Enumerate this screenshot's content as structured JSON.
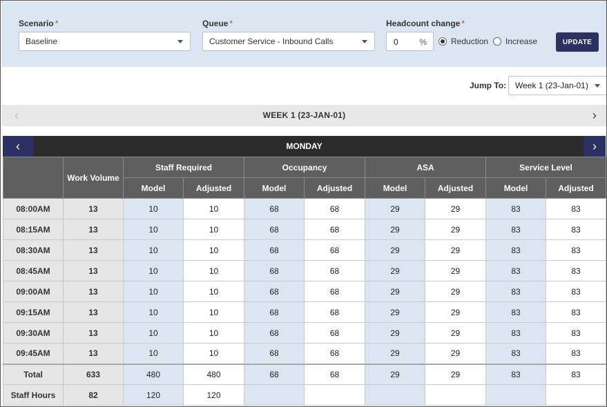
{
  "filters": {
    "scenario": {
      "label": "Scenario",
      "required": "*",
      "value": "Baseline"
    },
    "queue": {
      "label": "Queue",
      "required": "*",
      "value": "Customer Service - Inbound Calls"
    },
    "headcount": {
      "label": "Headcount change",
      "required": "*",
      "value": "0",
      "unit": "%"
    },
    "radio": {
      "reduction": "Reduction",
      "increase": "Increase",
      "selected": "Reduction"
    },
    "update_label": "UPDATE"
  },
  "jump": {
    "label": "Jump To:",
    "value": "Week 1 (23-Jan-01)"
  },
  "week": {
    "title": "WEEK 1 (23-JAN-01)",
    "prev": "‹",
    "next": "›"
  },
  "day": {
    "title": "MONDAY",
    "prev": "‹",
    "next": "›"
  },
  "table": {
    "headers": {
      "work_volume": "Work Volume",
      "groups": [
        "Staff Required",
        "Occupancy",
        "ASA",
        "Service Level"
      ],
      "model": "Model",
      "adjusted": "Adjusted"
    },
    "rows": [
      {
        "time": "08:00AM",
        "wv": "13",
        "vals": [
          "10",
          "10",
          "68",
          "68",
          "29",
          "29",
          "83",
          "83"
        ]
      },
      {
        "time": "08:15AM",
        "wv": "13",
        "vals": [
          "10",
          "10",
          "68",
          "68",
          "29",
          "29",
          "83",
          "83"
        ]
      },
      {
        "time": "08:30AM",
        "wv": "13",
        "vals": [
          "10",
          "10",
          "68",
          "68",
          "29",
          "29",
          "83",
          "83"
        ]
      },
      {
        "time": "08:45AM",
        "wv": "13",
        "vals": [
          "10",
          "10",
          "68",
          "68",
          "29",
          "29",
          "83",
          "83"
        ]
      },
      {
        "time": "09:00AM",
        "wv": "13",
        "vals": [
          "10",
          "10",
          "68",
          "68",
          "29",
          "29",
          "83",
          "83"
        ]
      },
      {
        "time": "09:15AM",
        "wv": "13",
        "vals": [
          "10",
          "10",
          "68",
          "68",
          "29",
          "29",
          "83",
          "83"
        ]
      },
      {
        "time": "09:30AM",
        "wv": "13",
        "vals": [
          "10",
          "10",
          "68",
          "68",
          "29",
          "29",
          "83",
          "83"
        ]
      },
      {
        "time": "09:45AM",
        "wv": "13",
        "vals": [
          "10",
          "10",
          "68",
          "68",
          "29",
          "29",
          "83",
          "83"
        ]
      }
    ],
    "total": {
      "label": "Total",
      "wv": "633",
      "vals": [
        "480",
        "480",
        "68",
        "68",
        "29",
        "29",
        "83",
        "83"
      ]
    },
    "staff_hours": {
      "label": "Staff Hours",
      "wv": "82",
      "vals": [
        "120",
        "120",
        "",
        "",
        "",
        "",
        "",
        ""
      ]
    }
  },
  "colors": {
    "accent": "#2c3163",
    "filter_bg": "#dce6f2",
    "header_bg": "#5f5f5f",
    "day_bg": "#2b2b2b",
    "required": "#c0392b"
  }
}
